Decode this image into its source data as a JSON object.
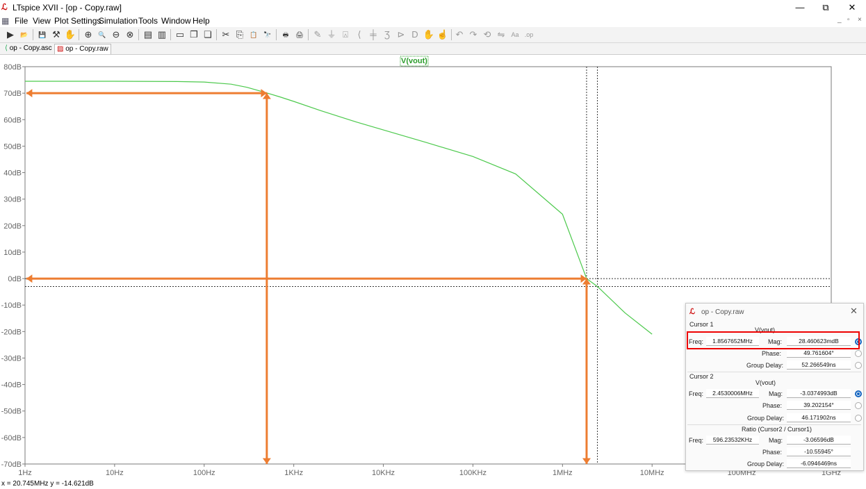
{
  "window": {
    "title": "LTspice XVII - [op - Copy.raw]",
    "controls": [
      "—",
      "⧉",
      "✕"
    ]
  },
  "menu": [
    "File",
    "View",
    "Plot Settings",
    "Simulation",
    "Tools",
    "Window",
    "Help"
  ],
  "toolbar": [
    {
      "name": "run-icon",
      "glyph": "▶"
    },
    {
      "name": "open-icon",
      "glyph": "📂"
    },
    {
      "name": "save-icon",
      "glyph": "💾"
    },
    {
      "name": "control-panel-icon",
      "glyph": "⚒"
    },
    {
      "name": "halt-icon",
      "glyph": "✋"
    },
    {
      "name": "zoom-in-icon",
      "glyph": "⊕"
    },
    {
      "name": "zoom-area-icon",
      "glyph": "🔍"
    },
    {
      "name": "zoom-out-icon",
      "glyph": "⊖"
    },
    {
      "name": "zoom-cancel-icon",
      "glyph": "⊗"
    },
    {
      "name": "autorange-icon",
      "glyph": "▤"
    },
    {
      "name": "autorange-y-icon",
      "glyph": "▥"
    },
    {
      "name": "tile-horizontal-icon",
      "glyph": "▭"
    },
    {
      "name": "cascade-icon",
      "glyph": "❐"
    },
    {
      "name": "tile-vertical-icon",
      "glyph": "❏"
    },
    {
      "name": "cut-icon",
      "glyph": "✂"
    },
    {
      "name": "copy-icon",
      "glyph": "⎘"
    },
    {
      "name": "paste-icon",
      "glyph": "📋"
    },
    {
      "name": "find-icon",
      "glyph": "🔭"
    },
    {
      "name": "print-preview-icon",
      "glyph": "🖶"
    },
    {
      "name": "print-icon",
      "glyph": "🖨"
    },
    {
      "name": "wire-icon",
      "glyph": "✎"
    },
    {
      "name": "ground-icon",
      "glyph": "⏚"
    },
    {
      "name": "label-icon",
      "glyph": "⍓"
    },
    {
      "name": "resistor-icon",
      "glyph": "⟨"
    },
    {
      "name": "capacitor-icon",
      "glyph": "╪"
    },
    {
      "name": "inductor-icon",
      "glyph": "Ʒ"
    },
    {
      "name": "diode-icon",
      "glyph": "⊳"
    },
    {
      "name": "component-icon",
      "glyph": "D"
    },
    {
      "name": "move-icon",
      "glyph": "✋"
    },
    {
      "name": "drag-icon",
      "glyph": "☝"
    },
    {
      "name": "undo-icon",
      "glyph": "↶"
    },
    {
      "name": "redo-icon",
      "glyph": "↷"
    },
    {
      "name": "rotate-icon",
      "glyph": "⟲"
    },
    {
      "name": "mirror-icon",
      "glyph": "⇋"
    },
    {
      "name": "text-icon",
      "glyph": "Aa"
    },
    {
      "name": "spice-directive-icon",
      "glyph": ".op"
    }
  ],
  "tabs": [
    {
      "label": "op - Copy.asc",
      "icon": "schematic-icon",
      "active": false
    },
    {
      "label": "op - Copy.raw",
      "icon": "waveform-icon",
      "active": true
    }
  ],
  "colors": {
    "trace": "#4cc94c",
    "arrow": "#ed7d31",
    "highlight": "#e00000",
    "axis": "#7a7a7a"
  },
  "chart_data": {
    "type": "line",
    "trace_label": "V(vout)",
    "x_scale": "log",
    "x_ticks": [
      "1Hz",
      "10Hz",
      "100Hz",
      "1KHz",
      "10KHz",
      "100KHz",
      "1MHz",
      "10MHz",
      "100MHz",
      "1GHz"
    ],
    "y_ticks": [
      "80dB",
      "70dB",
      "60dB",
      "50dB",
      "40dB",
      "30dB",
      "20dB",
      "10dB",
      "0dB",
      "-10dB",
      "-20dB",
      "-30dB",
      "-40dB",
      "-50dB",
      "-60dB",
      "-70dB"
    ],
    "ylim": [
      -70,
      80
    ],
    "xlim_hz": [
      1,
      1000000000
    ],
    "series": [
      {
        "name": "V(vout)",
        "x_hz": [
          1,
          10,
          50,
          100,
          200,
          300,
          500,
          700,
          1000,
          2000,
          5000,
          10000,
          30000,
          100000,
          300000,
          1000000,
          1856765,
          2453001,
          5000000,
          10000000
        ],
        "y_db": [
          74.5,
          74.5,
          74.4,
          74.2,
          73.4,
          72.2,
          70.1,
          68.6,
          66.9,
          63.4,
          59.1,
          56.1,
          51.4,
          46.1,
          39.5,
          24.3,
          0.0,
          -3.0,
          -13.0,
          -21.0
        ]
      }
    ],
    "cursor_lines": {
      "vertical_hz": [
        1856765,
        2453001
      ],
      "horizontal_db": [
        0,
        -3
      ]
    },
    "annotation_arrows": [
      {
        "orientation": "horizontal",
        "from_hz": 1,
        "to_hz": 500,
        "at_db": 70
      },
      {
        "orientation": "vertical",
        "at_hz": 500,
        "from_db": 70,
        "to_db": -70
      },
      {
        "orientation": "horizontal",
        "from_hz": 1,
        "to_hz": 1856765,
        "at_db": 0
      },
      {
        "orientation": "vertical",
        "at_hz": 1856765,
        "from_db": 0,
        "to_db": -70
      }
    ]
  },
  "statusbar": {
    "readout": "x = 20.745MHz    y = -14.621dB"
  },
  "cursor_panel": {
    "title": "op - Copy.raw",
    "cursor1": {
      "heading": "Cursor 1",
      "trace": "V(vout)",
      "freq_label": "Freq:",
      "freq": "1.8567652MHz",
      "mag_label": "Mag:",
      "mag": "28.460623mdB",
      "phase_label": "Phase:",
      "phase": "49.761604°",
      "gd_label": "Group Delay:",
      "gd": "52.266549ns"
    },
    "cursor2": {
      "heading": "Cursor 2",
      "trace": "V(vout)",
      "freq_label": "Freq:",
      "freq": "2.4530006MHz",
      "mag_label": "Mag:",
      "mag": "-3.0374993dB",
      "phase_label": "Phase:",
      "phase": "39.202154°",
      "gd_label": "Group Delay:",
      "gd": "46.171902ns"
    },
    "ratio": {
      "heading": "Ratio (Cursor2 / Cursor1)",
      "freq_label": "Freq:",
      "freq": "596.23532KHz",
      "mag_label": "Mag:",
      "mag": "-3.06596dB",
      "phase_label": "Phase:",
      "phase": "-10.55945°",
      "gd_label": "Group Delay:",
      "gd": "-6.0946469ns"
    }
  }
}
